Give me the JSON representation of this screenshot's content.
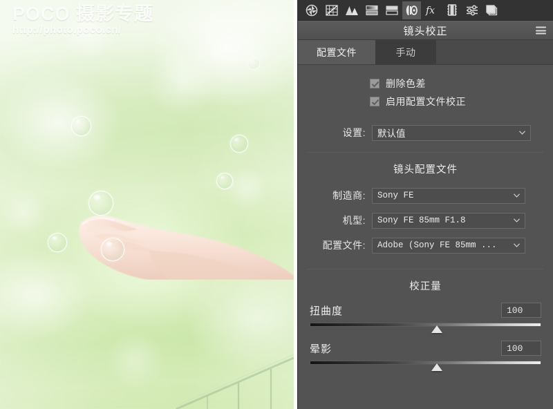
{
  "photo": {
    "watermark_title": "POCO 摄影专题",
    "watermark_url": "http://photo.poco.cn/",
    "description": "hand-with-bubbles"
  },
  "panel": {
    "title": "镜头校正",
    "menu_icon": "hamburger-icon",
    "iconbar": [
      {
        "name": "basic-panel-icon",
        "glyph": "aperture",
        "active": false
      },
      {
        "name": "tone-curve-icon",
        "glyph": "grid",
        "active": false
      },
      {
        "name": "detail-icon",
        "glyph": "mountains",
        "active": false
      },
      {
        "name": "hsl-grayscale-icon",
        "glyph": "sliders-stack",
        "active": false
      },
      {
        "name": "split-toning-icon",
        "glyph": "two-bars",
        "active": false
      },
      {
        "name": "lens-correction-icon",
        "glyph": "lens",
        "active": true
      },
      {
        "name": "effects-icon",
        "glyph": "fx",
        "active": false
      },
      {
        "name": "calibration-icon",
        "glyph": "filmstrip",
        "active": false
      },
      {
        "name": "presets-icon",
        "glyph": "equalizer",
        "active": false
      },
      {
        "name": "snapshots-icon",
        "glyph": "layers",
        "active": false
      }
    ],
    "tabs": [
      {
        "label": "配置文件",
        "selected": true
      },
      {
        "label": "手动",
        "selected": false
      }
    ],
    "checkboxes": [
      {
        "label": "删除色差",
        "checked": true
      },
      {
        "label": "启用配置文件校正",
        "checked": true
      }
    ],
    "settings_row": {
      "label": "设置:",
      "value": "默认值"
    },
    "lens_profile": {
      "heading": "镜头配置文件",
      "fields": [
        {
          "label": "制造商:",
          "value": "Sony FE"
        },
        {
          "label": "机型:",
          "value": "Sony FE 85mm F1.8"
        },
        {
          "label": "配置文件:",
          "value": "Adobe (Sony FE 85mm ..."
        }
      ]
    },
    "correction": {
      "heading": "校正量",
      "sliders": [
        {
          "label": "扭曲度",
          "value": "100",
          "position_pct": 55
        },
        {
          "label": "晕影",
          "value": "100",
          "position_pct": 55
        }
      ]
    },
    "colors": {
      "panel_bg": "#535353",
      "iconbar_bg": "#333333",
      "tab_active_bg": "#5a5a5a",
      "tab_inactive_bg": "#3c3c3c",
      "text": "#e8e8e8"
    }
  }
}
